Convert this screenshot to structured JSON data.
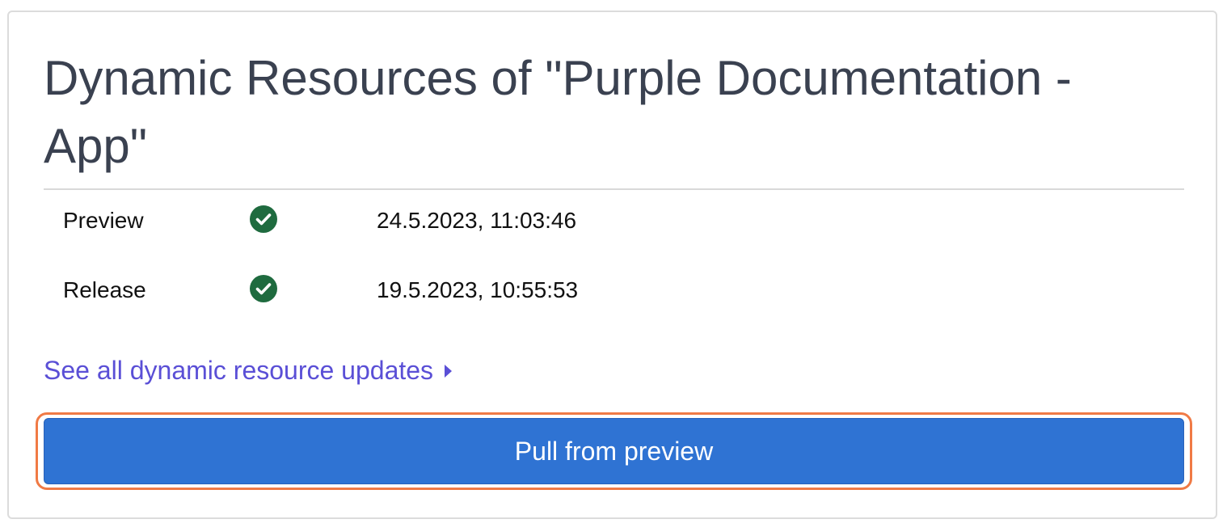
{
  "card": {
    "title": "Dynamic Resources of \"Purple Documentation - App\""
  },
  "resources": [
    {
      "label": "Preview",
      "status_icon": "check-circle-icon",
      "timestamp": "24.5.2023, 11:03:46"
    },
    {
      "label": "Release",
      "status_icon": "check-circle-icon",
      "timestamp": "19.5.2023, 10:55:53"
    }
  ],
  "updates_link": {
    "label": "See all dynamic resource updates",
    "icon": "caret-right-icon"
  },
  "pull_button": {
    "label": "Pull from preview"
  },
  "colors": {
    "title": "#3a4150",
    "status_ok": "#1f6b3f",
    "link": "#5a4fd6",
    "button_bg": "#2f73d3",
    "button_text": "#ffffff",
    "focus_ring": "#f07a45",
    "divider": "#d9d9d9"
  }
}
